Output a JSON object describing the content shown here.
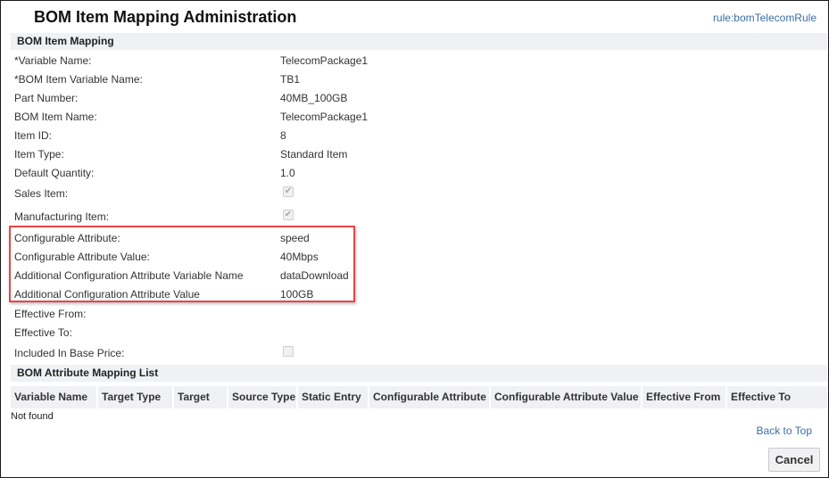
{
  "header": {
    "title": "BOM Item Mapping Administration",
    "rule_link": "rule:bomTelecomRule"
  },
  "section_mapping": {
    "title": "BOM Item Mapping",
    "fields": [
      {
        "label": "*Variable Name:",
        "value": "TelecomPackage1"
      },
      {
        "label": "*BOM Item Variable Name:",
        "value": "TB1"
      },
      {
        "label": "Part Number:",
        "value": "40MB_100GB"
      },
      {
        "label": "BOM Item Name:",
        "value": "TelecomPackage1"
      },
      {
        "label": "Item ID:",
        "value": "8"
      },
      {
        "label": "Item Type:",
        "value": "Standard Item"
      },
      {
        "label": "Default Quantity:",
        "value": "1.0"
      }
    ],
    "checkboxes": [
      {
        "label": "Sales Item:",
        "checked": true,
        "disabled": true
      },
      {
        "label": "Manufacturing Item:",
        "checked": true,
        "disabled": true
      }
    ],
    "highlighted_fields": [
      {
        "label": "Configurable Attribute:",
        "value": "speed"
      },
      {
        "label": "Configurable Attribute Value:",
        "value": "40Mbps"
      },
      {
        "label": "Additional Configuration Attribute Variable Name",
        "value": "dataDownload"
      },
      {
        "label": "Additional Configuration Attribute Value",
        "value": "100GB"
      }
    ],
    "effective_from": {
      "label": "Effective From:",
      "value": ""
    },
    "effective_to": {
      "label": "Effective To:",
      "value": ""
    },
    "included_in_base_price": {
      "label": "Included In Base Price:",
      "checked": false,
      "disabled": true
    },
    "highlight_color": "#e8454a"
  },
  "section_attribute_list": {
    "title": "BOM Attribute Mapping List",
    "columns": [
      "Variable Name",
      "Target Type",
      "Target",
      "Source Type",
      "Static Entry",
      "Configurable Attribute",
      "Configurable Attribute Value",
      "Effective From",
      "Effective To"
    ],
    "empty_text": "Not found"
  },
  "footer": {
    "back_to_top": "Back to Top",
    "cancel_label": "Cancel"
  },
  "colors": {
    "link": "#3a6ea5",
    "section_bg": "#f0f1f5"
  }
}
